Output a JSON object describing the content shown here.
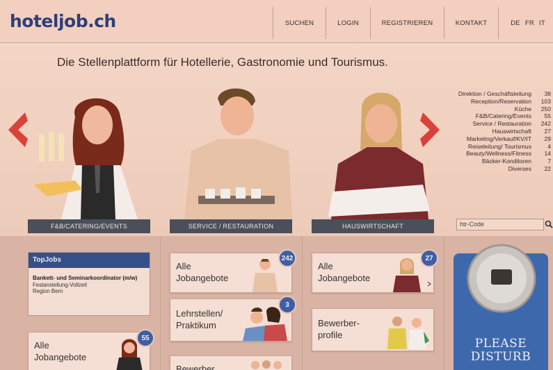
{
  "header": {
    "logo": "hoteljob.ch",
    "nav": [
      "SUCHEN",
      "LOGIN",
      "REGISTRIEREN",
      "KONTAKT"
    ],
    "languages": [
      "DE",
      "FR",
      "IT"
    ]
  },
  "tagline": "Die Stellenplattform für Hotellerie, Gastronomie und Tourismus.",
  "categories": [
    {
      "label": "Direktion / Geschäftsleitung",
      "count": "38"
    },
    {
      "label": "Reception/Reservation",
      "count": "103"
    },
    {
      "label": "Küche",
      "count": "250"
    },
    {
      "label": "F&B/Catering/Events",
      "count": "55"
    },
    {
      "label": "Service / Restauration",
      "count": "242"
    },
    {
      "label": "Hauswirtschaft",
      "count": "27"
    },
    {
      "label": "Marketing/Verkauf/KV/IT",
      "count": "29"
    },
    {
      "label": "Reiseleitung/ Tourismus",
      "count": "4"
    },
    {
      "label": "Beauty/Wellness/Fitness",
      "count": "14"
    },
    {
      "label": "Bäcker-Konditoren",
      "count": "7"
    },
    {
      "label": "Diverses",
      "count": "22"
    }
  ],
  "category_bars": [
    "F&B/CATERING/EVENTS",
    "SERVICE / RESTAURATION",
    "HAUSWIRTSCHAFT"
  ],
  "htr": {
    "placeholder": "htr-Code"
  },
  "topjobs": {
    "heading": "TopJobs",
    "title": "Bankett- und Seminarkoordinator (m/w)",
    "type": "Festanstellung-Vollzeit",
    "region": "Region Bern"
  },
  "cards": {
    "col1_all": {
      "line1": "Alle",
      "line2": "Jobangebote",
      "badge": "55"
    },
    "col2_all": {
      "line1": "Alle",
      "line2": "Jobangebote",
      "badge": "242"
    },
    "col2_lehr": {
      "line1": "Lehrstellen/",
      "line2": "Praktikum",
      "badge": "3"
    },
    "col2_bew": {
      "line1": "Bewerber"
    },
    "col3_all": {
      "line1": "Alle",
      "line2": "Jobangebote",
      "badge": "27"
    },
    "col3_bew": {
      "line1": "Bewerber-",
      "line2": "profile"
    }
  },
  "please": {
    "line1": "PLEASE",
    "line2": "DISTURB"
  },
  "colors": {
    "brand": "#2c3f77",
    "badge": "#3d5fa4",
    "arrow": "#d9423a",
    "bar": "#4b4f59"
  }
}
